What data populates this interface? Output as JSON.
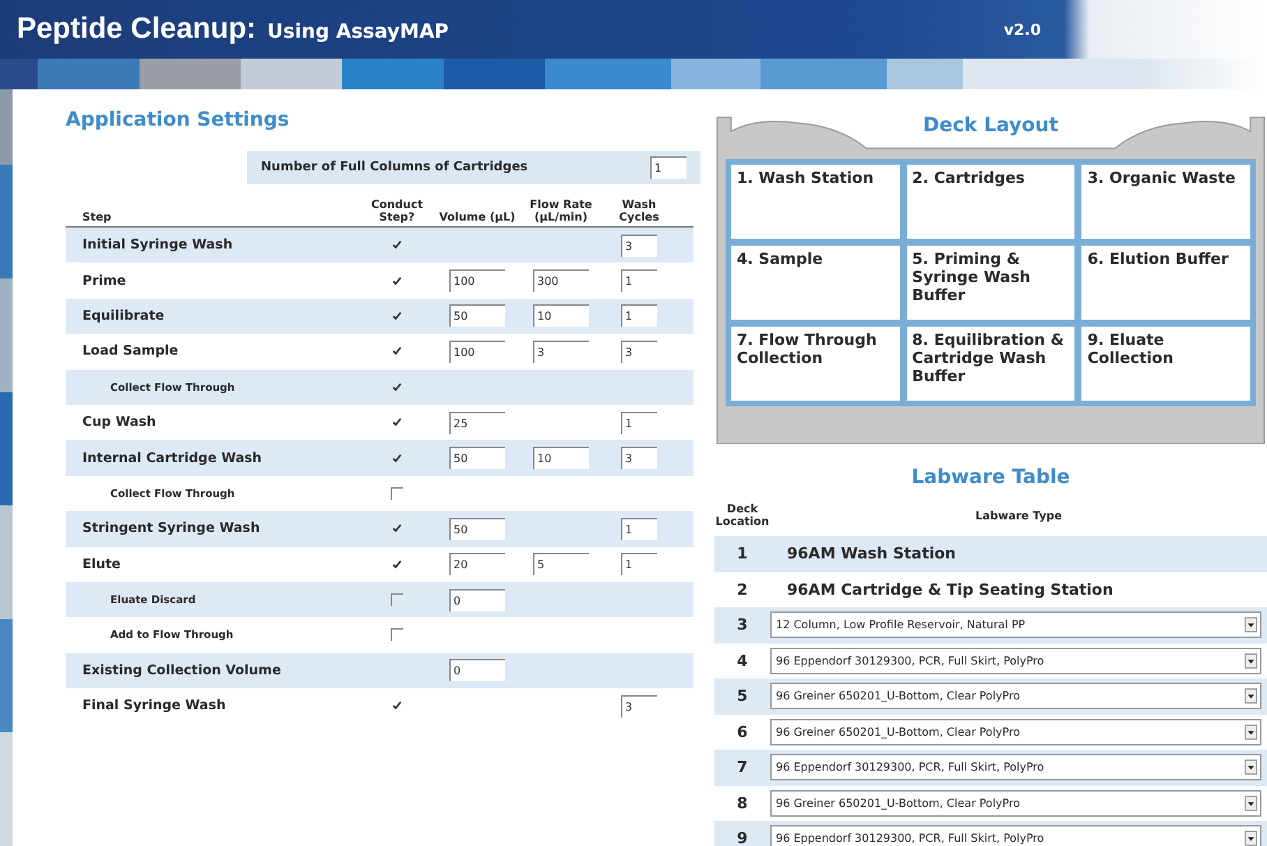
{
  "header": {
    "title": "Peptide Cleanup:",
    "subtitle": "Using AssayMAP",
    "version": "v2.0"
  },
  "settings": {
    "title": "Application Settings",
    "full_columns": {
      "label": "Number of Full Columns of Cartridges",
      "value": "1"
    },
    "columns": [
      "Step",
      "Conduct Step?",
      "Volume (µL)",
      "Flow Rate (µL/min)",
      "Wash Cycles"
    ],
    "steps": [
      {
        "name": "Initial Syringe Wash",
        "checked": true,
        "cycles": "3"
      },
      {
        "name": "Prime",
        "checked": true,
        "volume": "100",
        "flow": "300",
        "cycles": "1"
      },
      {
        "name": "Equilibrate",
        "checked": true,
        "volume": "50",
        "flow": "10",
        "cycles": "1"
      },
      {
        "name": "Load Sample",
        "checked": true,
        "volume": "100",
        "flow": "3",
        "cycles": "3",
        "children": [
          {
            "name": "Collect Flow Through",
            "checked": true
          }
        ]
      },
      {
        "name": "Cup Wash",
        "checked": true,
        "volume": "25",
        "cycles": "1"
      },
      {
        "name": "Internal Cartridge Wash",
        "checked": true,
        "volume": "50",
        "flow": "10",
        "cycles": "3",
        "children": [
          {
            "name": "Collect Flow Through",
            "checked": false
          }
        ]
      },
      {
        "name": "Stringent Syringe Wash",
        "checked": true,
        "volume": "50",
        "cycles": "1"
      },
      {
        "name": "Elute",
        "checked": true,
        "volume": "20",
        "flow": "5",
        "cycles": "1",
        "children": [
          {
            "name": "Eluate Discard",
            "checked": false,
            "volume": "0"
          },
          {
            "name": "Add to Flow Through",
            "checked": false
          }
        ]
      },
      {
        "name": "Existing Collection Volume",
        "volume": "0"
      },
      {
        "name": "Final Syringe Wash",
        "checked": true,
        "cycles": "3"
      }
    ]
  },
  "deck": {
    "title": "Deck Layout",
    "positions": [
      "1. Wash Station",
      "2. Cartridges",
      "3. Organic Waste",
      "4. Sample",
      "5. Priming & Syringe Wash Buffer",
      "6. Elution Buffer",
      "7. Flow Through Collection",
      "8. Equilibration & Cartridge Wash Buffer",
      "9. Eluate Collection"
    ]
  },
  "labware": {
    "title": "Labware Table",
    "columns": [
      "Deck Location",
      "Labware Type"
    ],
    "rows": [
      {
        "location": "1",
        "kind": "fixed",
        "type": "96AM Wash Station"
      },
      {
        "location": "2",
        "kind": "fixed",
        "type": "96AM Cartridge & Tip Seating Station"
      },
      {
        "location": "3",
        "kind": "select",
        "type": "12 Column, Low Profile Reservoir, Natural PP"
      },
      {
        "location": "4",
        "kind": "select",
        "type": "96 Eppendorf 30129300, PCR, Full Skirt, PolyPro"
      },
      {
        "location": "5",
        "kind": "select",
        "type": "96 Greiner 650201_U-Bottom, Clear PolyPro"
      },
      {
        "location": "6",
        "kind": "select",
        "type": "96 Greiner 650201_U-Bottom, Clear PolyPro"
      },
      {
        "location": "7",
        "kind": "select",
        "type": "96 Eppendorf 30129300, PCR, Full Skirt, PolyPro"
      },
      {
        "location": "8",
        "kind": "select",
        "type": "96 Greiner 650201_U-Bottom, Clear PolyPro"
      },
      {
        "location": "9",
        "kind": "select",
        "type": "96 Eppendorf 30129300, PCR, Full Skirt, PolyPro"
      }
    ]
  }
}
